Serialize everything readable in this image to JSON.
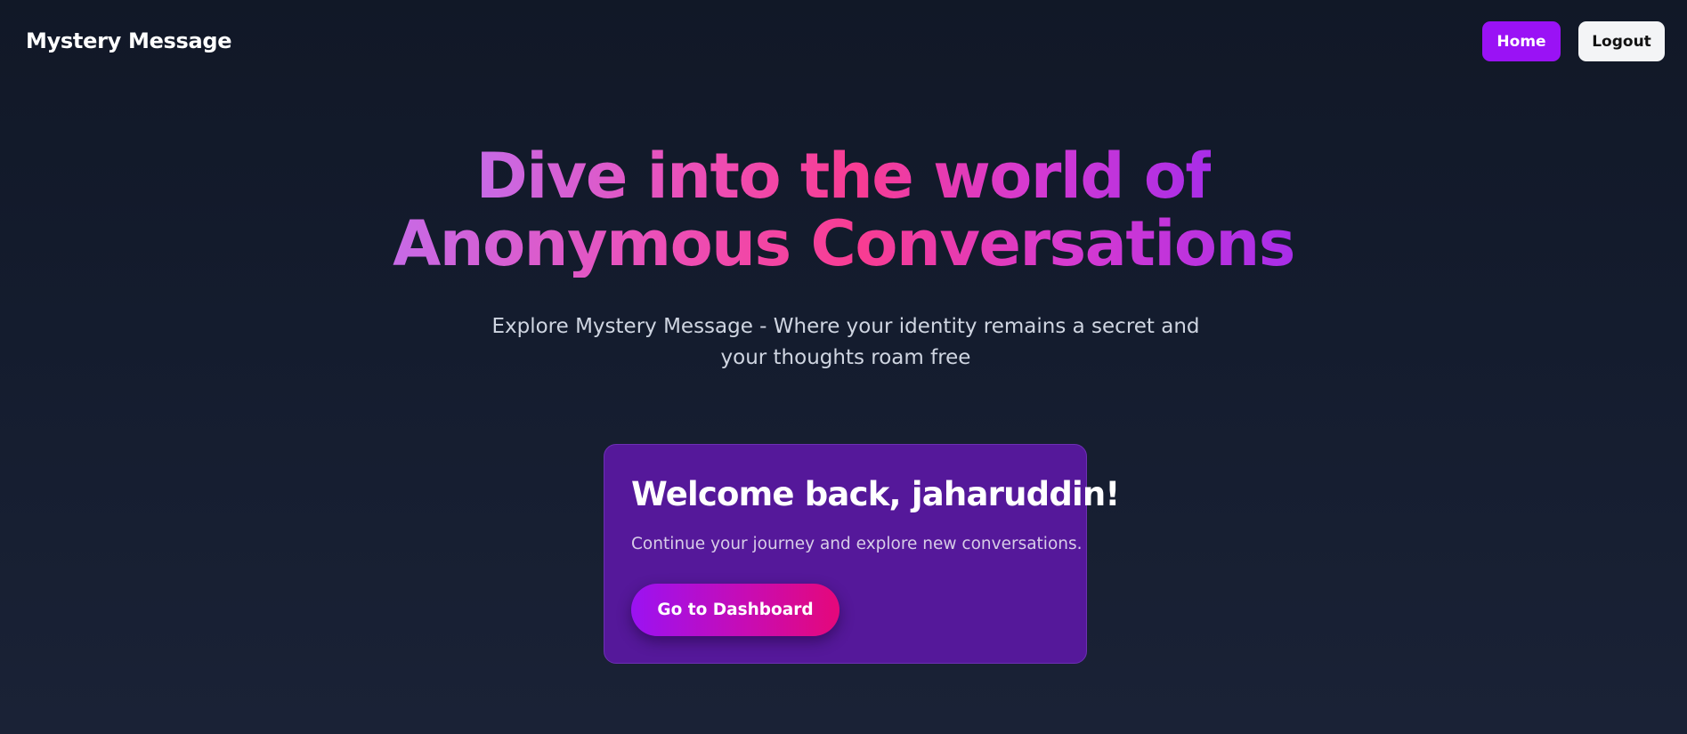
{
  "navbar": {
    "brand": "Mystery Message",
    "home_label": "Home",
    "logout_label": "Logout"
  },
  "hero": {
    "title_line1": "Dive into the world of",
    "title_line2": "Anonymous Conversations",
    "subtitle": "Explore Mystery Message - Where your identity remains a secret and your thoughts roam free"
  },
  "welcome_card": {
    "title": "Welcome back, jaharuddin!",
    "text": "Continue your journey and explore new conversations.",
    "button_label": "Go to Dashboard"
  },
  "colors": {
    "background": "#111827",
    "accent_purple": "#9a12f5",
    "accent_pink": "#f83c92",
    "card_background": "#55189a"
  }
}
